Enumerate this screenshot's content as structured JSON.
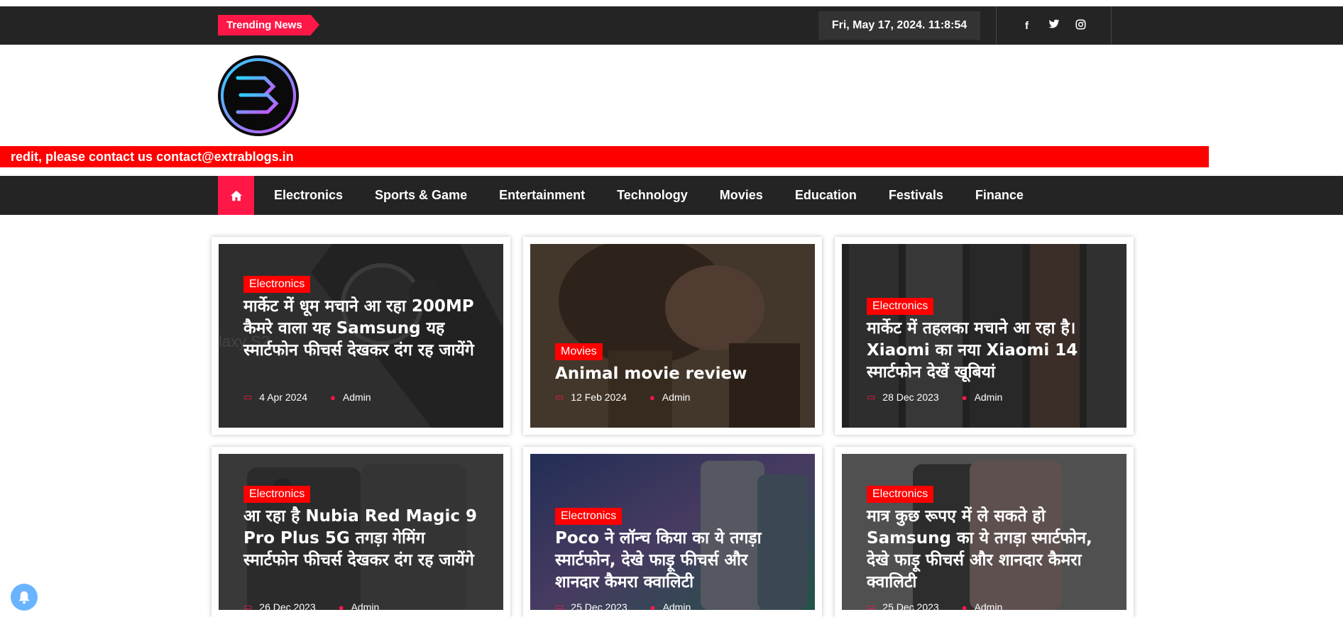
{
  "topbar": {
    "trending_label": "Trending News",
    "datetime": "Fri, May 17, 2024. 11:8:54",
    "social": [
      {
        "icon": "facebook-icon",
        "glyph": "f"
      },
      {
        "icon": "twitter-icon",
        "glyph": "🐦"
      },
      {
        "icon": "instagram-icon",
        "glyph": "◎"
      }
    ]
  },
  "marquee": {
    "text": "redit, please contact us contact@extrablogs.in"
  },
  "nav": {
    "home_icon": "home-icon",
    "items": [
      "Electronics",
      "Sports & Game",
      "Entertainment",
      "Technology",
      "Movies",
      "Education",
      "Festivals",
      "Finance"
    ]
  },
  "posts": [
    {
      "category": "Electronics",
      "title": "मार्केट में धूम मचाने आ रहा 200MP कैमरे वाला यह Samsung यह स्मार्टफोन फीचर्स देखकर दंग रह जायेंगे",
      "date": "4 Apr 2024",
      "author": "Admin"
    },
    {
      "category": "Movies",
      "title": "Animal movie review",
      "date": "12 Feb 2024",
      "author": "Admin"
    },
    {
      "category": "Electronics",
      "title": "मार्केट में तहलका मचाने आ रहा है। Xiaomi का नया Xiaomi 14 स्मार्टफोन देखें खूबियां",
      "date": "28 Dec 2023",
      "author": "Admin"
    },
    {
      "category": "Electronics",
      "title": "आ रहा है  Nubia Red Magic 9 Pro Plus 5G तगड़ा गेमिंग स्मार्टफोन फीचर्स देखकर दंग रह जायेंगे",
      "date": "26 Dec 2023",
      "author": "Admin"
    },
    {
      "category": "Electronics",
      "title": "Poco ने लॉन्च किया   का ये  तगड़ा स्मार्टफोन, देखे फाड़ू फीचर्स और शानदार कैमरा क्वालिटी",
      "date": "25 Dec 2023",
      "author": "Admin"
    },
    {
      "category": "Electronics",
      "title": "मात्र कुछ रूपए में ले सकते हो Samsung  का ये  तगड़ा स्मार्टफोन, देखे फाड़ू फीचर्स और शानदार कैमरा क्वालिटी",
      "date": "25 Dec 2023",
      "author": "Admin"
    }
  ],
  "colors": {
    "accent": "#ff1747",
    "marquee": "#ff0000",
    "bar": "#242424"
  }
}
